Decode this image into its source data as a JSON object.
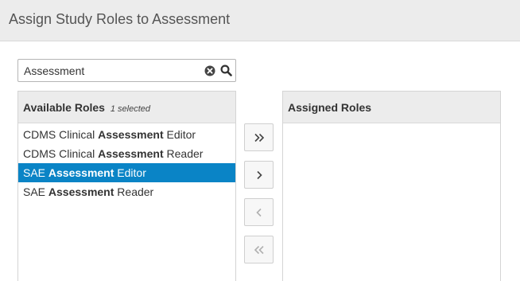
{
  "header": {
    "title": "Assign Study Roles to Assessment"
  },
  "search": {
    "value": "Assessment",
    "clear_icon": "clear-circle-icon",
    "search_icon": "magnifier-icon"
  },
  "available": {
    "title": "Available Roles",
    "selected_note": "1 selected",
    "items": [
      {
        "pre": "CDMS Clinical ",
        "bold": "Assessment",
        "post": " Editor",
        "selected": false
      },
      {
        "pre": "CDMS Clinical ",
        "bold": "Assessment",
        "post": " Reader",
        "selected": false
      },
      {
        "pre": "SAE ",
        "bold": "Assessment",
        "post": " Editor",
        "selected": true
      },
      {
        "pre": "SAE ",
        "bold": "Assessment",
        "post": " Reader",
        "selected": false
      }
    ]
  },
  "assigned": {
    "title": "Assigned Roles",
    "items": []
  },
  "controls": {
    "move_all_right": {
      "glyph": "»",
      "enabled": true
    },
    "move_right": {
      "glyph": "›",
      "enabled": true
    },
    "move_left": {
      "glyph": "‹",
      "enabled": false
    },
    "move_all_left": {
      "glyph": "«",
      "enabled": false
    }
  },
  "colors": {
    "selection": "#0a84c6",
    "header_bg": "#ececec"
  }
}
